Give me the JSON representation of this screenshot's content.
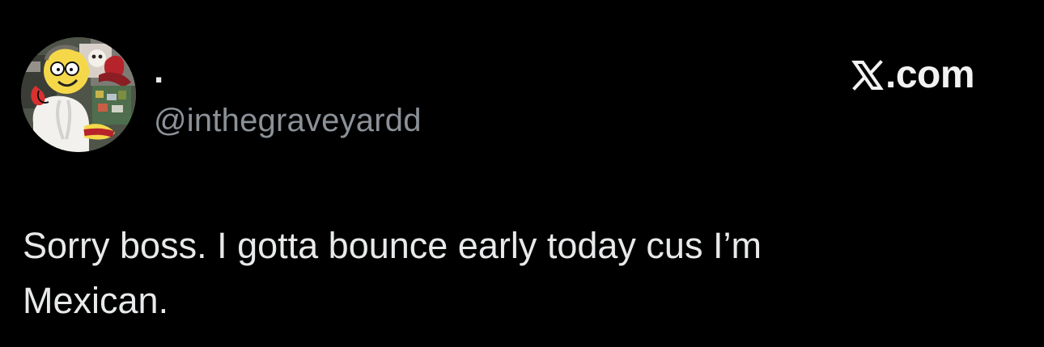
{
  "brand": {
    "icon": "x-logo-icon",
    "text": ".com"
  },
  "author": {
    "display_name": ".",
    "handle": "@inthegraveyardd",
    "avatar": "cartoon-avatar"
  },
  "tweet": {
    "lines": [
      "Sorry boss. I gotta bounce early today cus I’m",
      "Mexican."
    ]
  },
  "colors": {
    "background": "#000000",
    "primary_text": "#e7e9ea",
    "secondary_text": "#8b9197"
  }
}
